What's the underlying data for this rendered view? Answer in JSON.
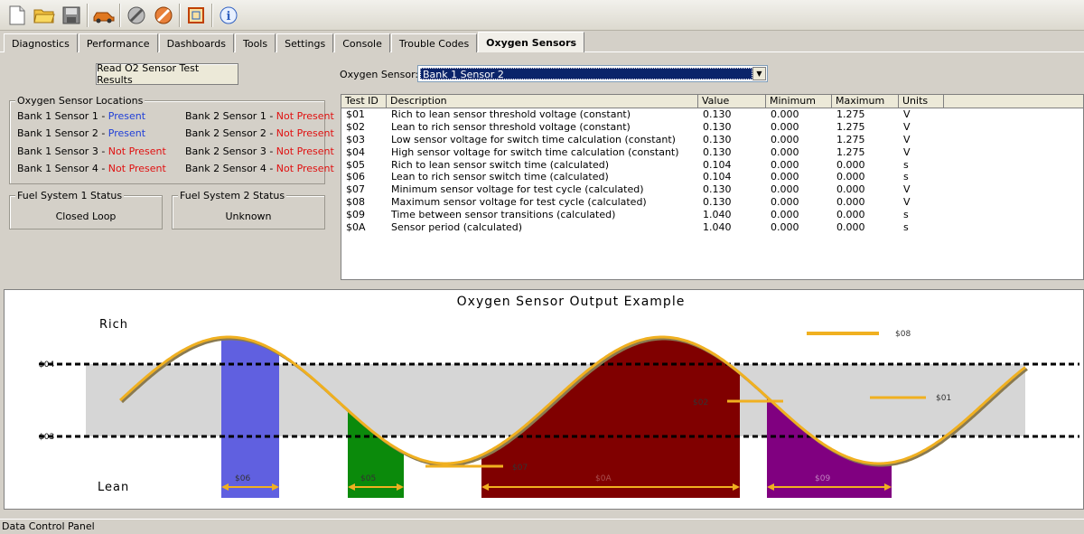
{
  "toolbar": {
    "buttons": [
      "new-file-icon",
      "open-folder-icon",
      "save-icon",
      "connect-vehicle-icon",
      "disconnect-icon",
      "disconnect-hardware-icon",
      "settings-frame-icon",
      "info-icon"
    ]
  },
  "tabs": [
    {
      "label": "Diagnostics",
      "active": false
    },
    {
      "label": "Performance",
      "active": false
    },
    {
      "label": "Dashboards",
      "active": false
    },
    {
      "label": "Tools",
      "active": false
    },
    {
      "label": "Settings",
      "active": false
    },
    {
      "label": "Console",
      "active": false
    },
    {
      "label": "Trouble Codes",
      "active": false
    },
    {
      "label": "Oxygen Sensors",
      "active": true
    }
  ],
  "read_button": "Read O2 Sensor Test Results",
  "locations": {
    "title": "Oxygen Sensor Locations",
    "bank1": [
      {
        "name": "Bank 1 Sensor 1",
        "sep": " - ",
        "status": "Present"
      },
      {
        "name": "Bank 1 Sensor 2",
        "sep": " - ",
        "status": "Present"
      },
      {
        "name": "Bank 1 Sensor 3",
        "sep": " - ",
        "status": "Not Present"
      },
      {
        "name": "Bank 1 Sensor 4",
        "sep": " - ",
        "status": "Not Present"
      }
    ],
    "bank2": [
      {
        "name": "Bank 2 Sensor 1",
        "sep": " - ",
        "status": "Not Present"
      },
      {
        "name": "Bank 2 Sensor 2",
        "sep": " - ",
        "status": "Not Present"
      },
      {
        "name": "Bank 2 Sensor 3",
        "sep": " - ",
        "status": "Not Present"
      },
      {
        "name": "Bank 2 Sensor 4",
        "sep": " - ",
        "status": "Not Present"
      }
    ]
  },
  "fuel1": {
    "title": "Fuel System 1 Status",
    "value": "Closed Loop"
  },
  "fuel2": {
    "title": "Fuel System 2 Status",
    "value": "Unknown"
  },
  "sensor_select": {
    "label": "Oxygen Sensor:",
    "value": "Bank 1 Sensor 2"
  },
  "table": {
    "headers": [
      "Test ID",
      "Description",
      "Value",
      "Minimum",
      "Maximum",
      "Units"
    ],
    "rows": [
      [
        "$01",
        "Rich to lean sensor threshold voltage (constant)",
        "0.130",
        "0.000",
        "1.275",
        "V"
      ],
      [
        "$02",
        "Lean to rich sensor threshold voltage (constant)",
        "0.130",
        "0.000",
        "1.275",
        "V"
      ],
      [
        "$03",
        "Low sensor voltage for switch time calculation (constant)",
        "0.130",
        "0.000",
        "1.275",
        "V"
      ],
      [
        "$04",
        "High sensor voltage for switch time calculation (constant)",
        "0.130",
        "0.000",
        "1.275",
        "V"
      ],
      [
        "$05",
        "Rich to lean sensor switch time (calculated)",
        "0.104",
        "0.000",
        "0.000",
        "s"
      ],
      [
        "$06",
        "Lean to rich sensor switch time (calculated)",
        "0.104",
        "0.000",
        "0.000",
        "s"
      ],
      [
        "$07",
        "Minimum sensor voltage for test cycle (calculated)",
        "0.130",
        "0.000",
        "0.000",
        "V"
      ],
      [
        "$08",
        "Maximum sensor voltage for test cycle (calculated)",
        "0.130",
        "0.000",
        "0.000",
        "V"
      ],
      [
        "$09",
        "Time between sensor transitions (calculated)",
        "1.040",
        "0.000",
        "0.000",
        "s"
      ],
      [
        "$0A",
        "Sensor period (calculated)",
        "1.040",
        "0.000",
        "0.000",
        "s"
      ]
    ]
  },
  "diagram": {
    "title": "Oxygen Sensor Output Example",
    "rich": "Rich",
    "lean": "Lean",
    "l04": "$04",
    "l03": "$03",
    "l06": "$06",
    "l05": "$05",
    "l07": "$07",
    "l0A": "$0A",
    "l02": "$02",
    "l08": "$08",
    "l01": "$01",
    "l09": "$09",
    "colors": {
      "blue": "#6060e0",
      "green": "#0b8a0b",
      "maroon": "#800000",
      "purple": "#800080",
      "wave": "#f0b020",
      "band": "#d6d6d6"
    }
  },
  "status_bar": "Data Control Panel"
}
